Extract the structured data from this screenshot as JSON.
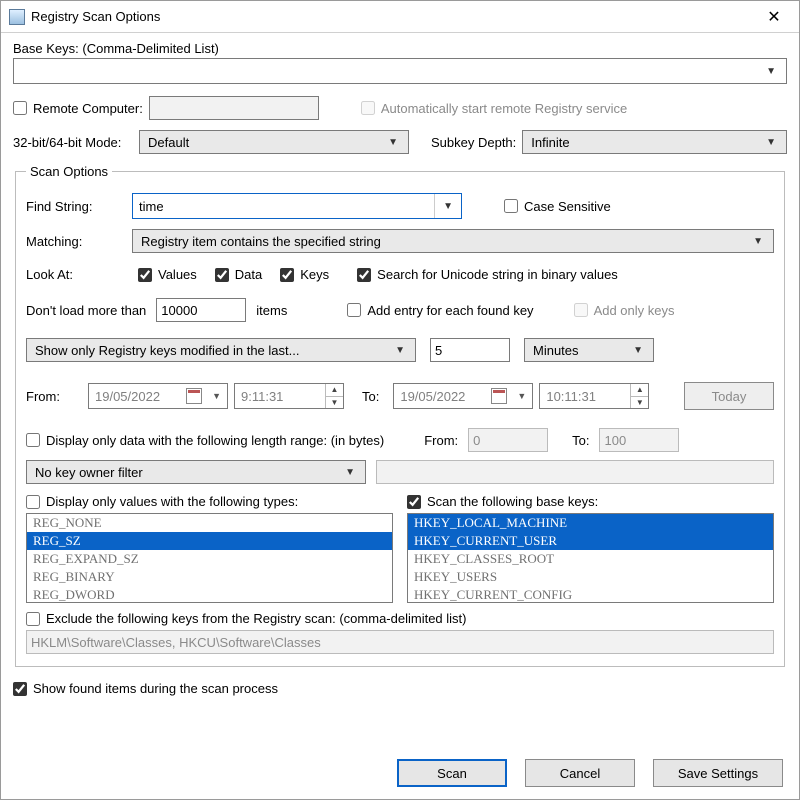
{
  "window": {
    "title": "Registry Scan Options"
  },
  "baseKeysLabel": "Base Keys:  (Comma-Delimited List)",
  "remote": {
    "label": "Remote Computer:",
    "auto": "Automatically start remote Registry service"
  },
  "bitMode": {
    "label": "32-bit/64-bit Mode:",
    "value": "Default"
  },
  "subkeyDepth": {
    "label": "Subkey Depth:",
    "value": "Infinite"
  },
  "scanOptions": {
    "legend": "Scan Options",
    "findStringLabel": "Find String:",
    "findStringValue": "time",
    "caseSensitive": "Case Sensitive",
    "matchingLabel": "Matching:",
    "matchingValue": "Registry item contains the specified string",
    "lookAtLabel": "Look At:",
    "lookAt": {
      "values": "Values",
      "data": "Data",
      "keys": "Keys"
    },
    "unicode": "Search for Unicode string in binary values",
    "dontLoadLabel": "Don't load more than",
    "dontLoadValue": "10000",
    "itemsLabel": "items",
    "addEntry": "Add entry for each found key",
    "addOnlyKeys": "Add only keys",
    "modifiedValue": "Show only Registry keys modified in the last...",
    "modNum": "5",
    "modUnit": "Minutes",
    "fromLabel": "From:",
    "toLabel": "To:",
    "fromDate": "19/05/2022",
    "fromTime": "9:11:31",
    "toDate": "19/05/2022",
    "toTime": "10:11:31",
    "today": "Today",
    "lenRange": "Display only data with the following length range: (in bytes)",
    "lenFromLabel": "From:",
    "lenFrom": "0",
    "lenToLabel": "To:",
    "lenTo": "100",
    "keyOwner": "No key owner filter",
    "typesLabel": "Display only values with the following types:",
    "baseKeysLabel": "Scan the following base keys:",
    "regTypes": [
      "REG_NONE",
      "REG_SZ",
      "REG_EXPAND_SZ",
      "REG_BINARY",
      "REG_DWORD"
    ],
    "regTypesSelected": [
      1
    ],
    "baseKeys": [
      "HKEY_LOCAL_MACHINE",
      "HKEY_CURRENT_USER",
      "HKEY_CLASSES_ROOT",
      "HKEY_USERS",
      "HKEY_CURRENT_CONFIG"
    ],
    "baseKeysSelected": [
      0,
      1
    ],
    "excludeLabel": "Exclude the following keys from the Registry scan: (comma-delimited list)",
    "excludeValue": "HKLM\\Software\\Classes, HKCU\\Software\\Classes"
  },
  "showFound": "Show found items during the scan process",
  "buttons": {
    "scan": "Scan",
    "cancel": "Cancel",
    "save": "Save Settings"
  }
}
